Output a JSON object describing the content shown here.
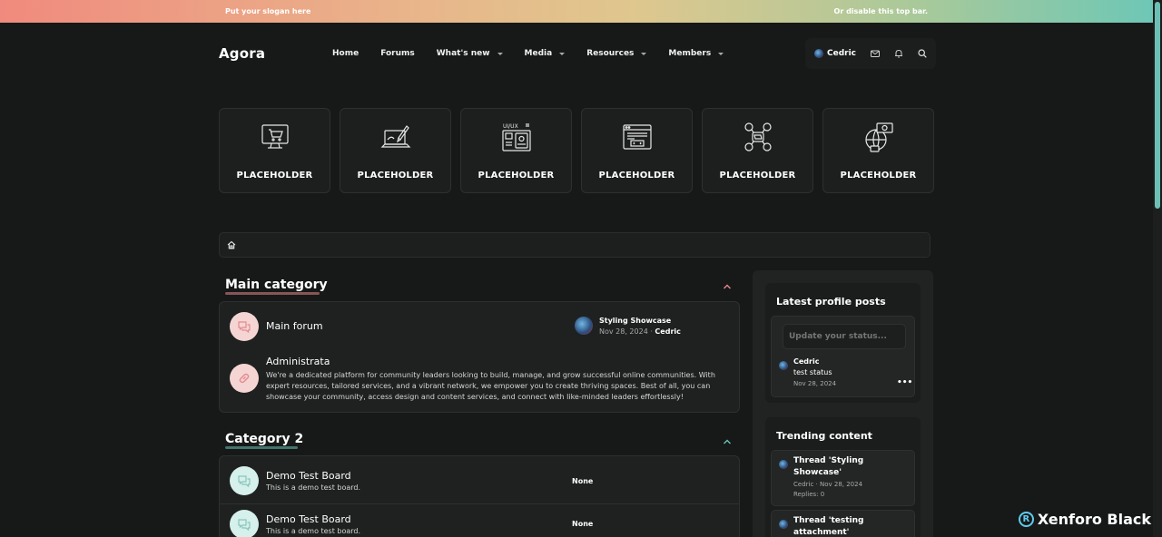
{
  "topbar": {
    "slogan": "Put your slogan here",
    "right_text": "Or disable this top bar."
  },
  "header": {
    "logo": "Agora",
    "nav": [
      "Home",
      "Forums",
      "What's new",
      "Media",
      "Resources",
      "Members"
    ],
    "user_name": "Cedric"
  },
  "tiles": [
    {
      "label": "PLACEHOLDER",
      "icon": "shop-monitor-icon"
    },
    {
      "label": "PLACEHOLDER",
      "icon": "laptop-pen-icon"
    },
    {
      "label": "PLACEHOLDER",
      "icon": "ui-ux-icon"
    },
    {
      "label": "PLACEHOLDER",
      "icon": "code-window-icon"
    },
    {
      "label": "PLACEHOLDER",
      "icon": "social-network-icon"
    },
    {
      "label": "PLACEHOLDER",
      "icon": "globe-money-icon"
    }
  ],
  "categories": [
    {
      "title": "Main category",
      "accent": "#e8868c",
      "nodes": [
        {
          "title": "Main forum",
          "icon": "chat-bubbles-icon",
          "last_post_title": "Styling Showcase",
          "last_post_date": "Nov 28, 2024",
          "last_post_user": "Cedric"
        },
        {
          "title": "Administrata",
          "icon": "link-icon",
          "description": "We're a dedicated platform for community leaders looking to build, manage, and grow successful online communities. With expert resources, tailored services, and a vibrant network, we empower you to create thriving spaces. Best of all, you can showcase your community, access design and content services, and connect with like-minded leaders effortlessly!"
        }
      ]
    },
    {
      "title": "Category 2",
      "accent": "#6cc0b3",
      "nodes": [
        {
          "title": "Demo Test Board",
          "description": "This is a demo test board.",
          "last_post": "None"
        },
        {
          "title": "Demo Test Board",
          "description": "This is a demo test board.",
          "last_post": "None"
        }
      ]
    }
  ],
  "sidebar": {
    "profile_posts": {
      "title": "Latest profile posts",
      "status_placeholder": "Update your status...",
      "post": {
        "user": "Cedric",
        "text": "test status",
        "date": "Nov 28, 2024",
        "more": "•••"
      }
    },
    "trending": {
      "title": "Trending content",
      "items": [
        {
          "line1": "Thread 'Styling",
          "line2": "Showcase'",
          "meta": "Cedric · Nov 28, 2024",
          "replies": "Replies: 0"
        },
        {
          "line1": "Thread 'testing",
          "line2": "attachment'"
        }
      ]
    }
  },
  "watermark": {
    "symbol": "R",
    "text": "Xenforo Black"
  }
}
